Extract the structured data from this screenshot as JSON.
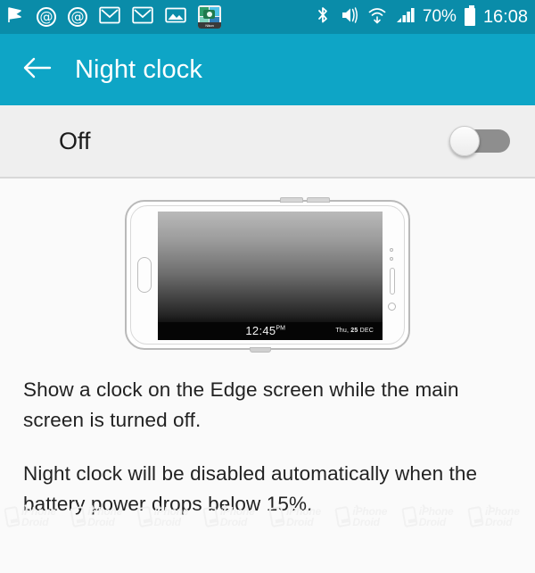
{
  "status_bar": {
    "background_color": "#0a8ca9",
    "notification_icons": [
      "flag-icon",
      "email-at-icon",
      "email-at-icon",
      "gmail-icon",
      "gmail-icon",
      "gallery-image-icon",
      "nikon-camera-icon"
    ],
    "nikon_label": "Nikon",
    "system_icons": [
      "bluetooth-icon",
      "mute-icon",
      "wifi-icon",
      "signal-icon"
    ],
    "battery_percent": "70%",
    "clock": "16:08"
  },
  "app_bar": {
    "background_color": "#0ea5c6",
    "back_icon": "back-arrow-icon",
    "title": "Night clock"
  },
  "toggle_row": {
    "label": "Off",
    "state": "off",
    "background_color": "#efefef"
  },
  "illustration": {
    "name": "night-clock-phone-preview",
    "screen_time": "12:45",
    "screen_time_meridiem": "PM",
    "screen_date_prefix": "Thu, ",
    "screen_date_day": "25",
    "screen_date_month": " DEC"
  },
  "description": {
    "paragraph_1": "Show a clock on the Edge screen while the main screen is turned off.",
    "paragraph_2": "Night clock will be disabled automatically when the battery power drops below 15%."
  },
  "watermark": {
    "line_1": "iPhone",
    "line_2": "Droid",
    "count": 8
  }
}
